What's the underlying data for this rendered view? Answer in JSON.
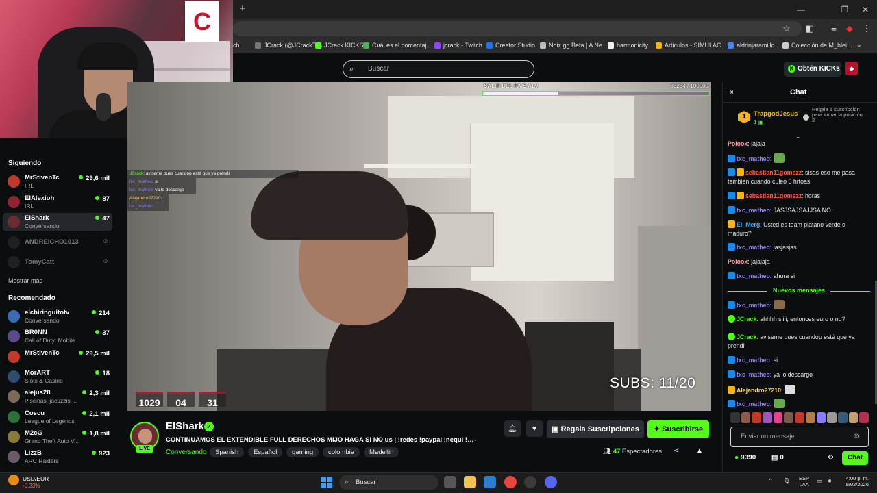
{
  "browser": {
    "new_tab": "+",
    "bookmarks": [
      {
        "label": "ch",
        "color": "#444"
      },
      {
        "label": "JCrack (@JCrackTV)...",
        "color": "#777"
      },
      {
        "label": "JCrack KICKS",
        "color": "#53fc18"
      },
      {
        "label": "Cuál es el porcentaj...",
        "color": "#4caf50"
      },
      {
        "label": "jcrack - Twitch",
        "color": "#9146ff"
      },
      {
        "label": "Creator Studio",
        "color": "#1877f2"
      },
      {
        "label": "Noiz.gg Beta | A Ne...",
        "color": "#bbbbbb"
      },
      {
        "label": "harmonicity",
        "color": "#eeeeee"
      },
      {
        "label": "Articulos - SIMULAC...",
        "color": "#f4b400"
      },
      {
        "label": "aldrinjaramillo",
        "color": "#4285f4"
      },
      {
        "label": "Colección de M_blei...",
        "color": "#cccccc"
      }
    ]
  },
  "header": {
    "search_placeholder": "Buscar",
    "kicks_button": "Obtén KICKs"
  },
  "sidebar": {
    "following_title": "Siguiendo",
    "following": [
      {
        "name": "MrStivenTc",
        "category": "IRL",
        "viewers": "29,6 mil",
        "online": true,
        "color": "#c0392b"
      },
      {
        "name": "ElAlexioh",
        "category": "IRL",
        "viewers": "87",
        "online": true,
        "color": "#8e2430"
      },
      {
        "name": "ElShark",
        "category": "Conversando",
        "viewers": "47",
        "online": true,
        "color": "#6b2c34"
      },
      {
        "name": "ANDREICHO1013",
        "category": "",
        "viewers": "",
        "online": false,
        "color": "#333"
      },
      {
        "name": "TomyCatt",
        "category": "",
        "viewers": "",
        "online": false,
        "color": "#333"
      }
    ],
    "show_more": "Mostrar más",
    "recommended_title": "Recomendado",
    "recommended": [
      {
        "name": "elchiringuitotv",
        "category": "Conversando",
        "viewers": "214",
        "color": "#3d6bb3"
      },
      {
        "name": "BR0NN",
        "category": "Call of Duty: Mobile",
        "viewers": "37",
        "color": "#5a4a8c"
      },
      {
        "name": "MrStivenTc",
        "category": "",
        "viewers": "29,5 mil",
        "color": "#c0392b"
      },
      {
        "name": "MorART",
        "category": "Slots & Casino",
        "viewers": "18",
        "color": "#2d4c6e"
      },
      {
        "name": "alejus28",
        "category": "Piscinas, jacuzzis ...",
        "viewers": "2,3 mil",
        "color": "#7a6a5a"
      },
      {
        "name": "Coscu",
        "category": "League of Legends",
        "viewers": "2,1 mil",
        "color": "#2f6f3a"
      },
      {
        "name": "M2cG",
        "category": "Grand Theft Auto V...",
        "viewers": "1,8 mil",
        "color": "#8a7a3a"
      },
      {
        "name": "LizzB",
        "category": "ARC Raiders",
        "viewers": "923",
        "color": "#6a5a6a"
      }
    ]
  },
  "video": {
    "goal_label": "SALIR DEL PAIS ALV",
    "goal_count": "33234 / 100000",
    "goal_progress": 0.332,
    "overlay_chat": [
      {
        "user": "JCrack",
        "text": ": aviseme pues cuandop esté que ya prendi",
        "cls": "u1"
      },
      {
        "user": "txc_matheo",
        "text": ": si",
        "cls": "u2"
      },
      {
        "user": "txc_matheo",
        "text": ": ya lo descargo",
        "cls": "u2"
      },
      {
        "user": "Alejandro27210",
        "text": ": ",
        "cls": "u3"
      },
      {
        "user": "txc_matheo",
        "text": ": ",
        "cls": "u2"
      }
    ],
    "subs": "SUBS: 11/20",
    "timer": [
      "1029",
      "04",
      "31"
    ]
  },
  "stream": {
    "streamer": "ElShark",
    "live": "LIVE",
    "title": "CONTINUAMOS EL EXTENDIBLE FULL DERECHOS MIJO HAGA SI NO us | !redes !paypal !nequi !e...",
    "category": "Conversando",
    "tags": [
      "Spanish",
      "Español",
      "gaming",
      "colombia",
      "Medellin"
    ],
    "gift_button": "Regala Suscripciones",
    "subscribe_button": "Suscribirse",
    "viewers_count": "47",
    "viewers_label": "Espectadores"
  },
  "chat": {
    "title": "Chat",
    "pinned": {
      "rank": "1",
      "user": "TrapgodJesus",
      "count": "1",
      "note": "Regala 1 suscripción para tomar la posición 2"
    },
    "messages": [
      {
        "badge": "",
        "user": "Poloox",
        "color": "#ff9aa6",
        "text": ": jajaja"
      },
      {
        "badge": "b1",
        "user": "txc_matheo",
        "color": "#8c7cf0",
        "text": ": ",
        "emote": "#6aa84f"
      },
      {
        "badge": "b1b2",
        "user": "sebastian11gomezz",
        "color": "#ff5a3c",
        "text": ": sisas eso me pasa tambien cuando culeo 5 hrtoas"
      },
      {
        "badge": "b1b2",
        "user": "sebastian11gomezz",
        "color": "#ff5a3c",
        "text": ": horas"
      },
      {
        "badge": "b1",
        "user": "txc_matheo",
        "color": "#8c7cf0",
        "text": ": JASJSAJSAJJSA NO"
      },
      {
        "badge": "b2",
        "user": "El_Merg",
        "color": "#3fa9f5",
        "text": ": Usted es team platano verde o maduro?"
      },
      {
        "badge": "b1",
        "user": "txc_matheo",
        "color": "#8c7cf0",
        "text": ": jasjasjas"
      },
      {
        "badge": "",
        "user": "Poloox",
        "color": "#ff9aa6",
        "text": ": jajajaja"
      },
      {
        "badge": "b1",
        "user": "txc_matheo",
        "color": "#8c7cf0",
        "text": ": ahora si"
      },
      {
        "badge": "b1",
        "user": "txc_matheo",
        "color": "#8c7cf0",
        "text": ": ",
        "emote": "#8a6a4a"
      },
      {
        "badge": "b3",
        "user": "JCrack",
        "color": "#53fc18",
        "text": ": ahhhh siiii, entonces euro o no?"
      },
      {
        "badge": "b3",
        "user": "JCrack",
        "color": "#53fc18",
        "text": ": aviseme pues cuandop esté que ya prendi"
      },
      {
        "badge": "b1",
        "user": "txc_matheo",
        "color": "#8c7cf0",
        "text": ": si"
      },
      {
        "badge": "b1",
        "user": "txc_matheo",
        "color": "#8c7cf0",
        "text": ": ya lo descargo"
      },
      {
        "badge": "b2",
        "user": "Alejandro27210",
        "color": "#f3d06b",
        "text": ": ",
        "emote": "#dddddd"
      },
      {
        "badge": "b1",
        "user": "txc_matheo",
        "color": "#8c7cf0",
        "text": ": ",
        "emote": "#6aa84f"
      }
    ],
    "new_messages": "Nuevos mensajes",
    "input_placeholder": "Enviar un mensaje",
    "kicks_balance": "9390",
    "chest_count": "0",
    "send_button": "Chat",
    "emote_colors": [
      "#333",
      "#8a5a4a",
      "#c0392b",
      "#9b59b6",
      "#e84393",
      "#7a5a4a",
      "#c0392b",
      "#b37a4c",
      "#8a7aff",
      "#999",
      "#3a5a7a",
      "#c8a070",
      "#b03050"
    ]
  },
  "taskbar": {
    "fx_pair": "USD/EUR",
    "fx_change": "-0,33%",
    "search": "Buscar",
    "lang_top": "ESP",
    "lang_bottom": "LAA",
    "time": "4:00 p. m.",
    "date": "8/02/2026"
  }
}
